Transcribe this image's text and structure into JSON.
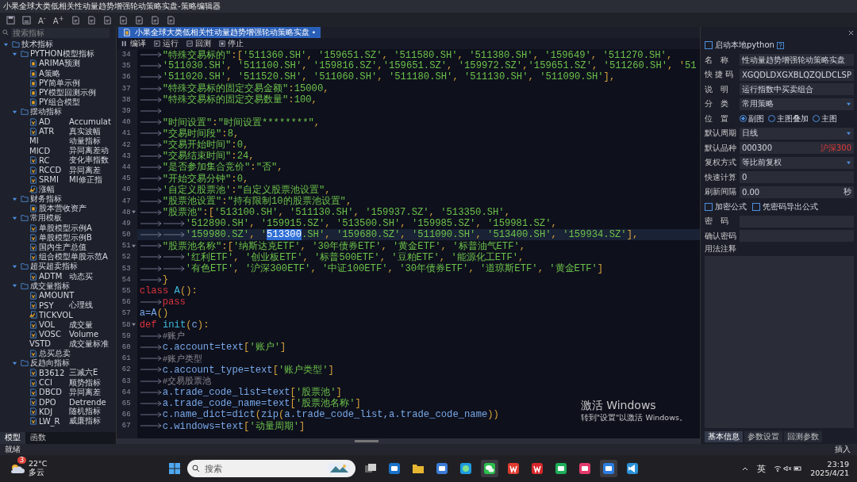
{
  "window": {
    "title": "小果全球大类低相关性动量趋势增强轮动策略实盘-策略编辑器"
  },
  "toolbar": {
    "icons": [
      {
        "kind": "save"
      },
      {
        "kind": "save-as"
      },
      {
        "kind": "font",
        "label": "A$^{-}$"
      },
      {
        "kind": "font",
        "label": "A$^{+}$"
      },
      {
        "kind": "doc"
      },
      {
        "kind": "doc"
      },
      {
        "kind": "doc"
      },
      {
        "kind": "doc"
      },
      {
        "kind": "doc"
      },
      {
        "kind": "doc"
      },
      {
        "kind": "doc"
      }
    ]
  },
  "sidebar": {
    "search": {
      "placeholder": "搜索指标"
    },
    "tree": [
      {
        "label": "技术指标",
        "kind": "folder",
        "expanded": true,
        "children": [
          {
            "label": "PYTHON模型指标",
            "kind": "folder",
            "expanded": true,
            "children": [
              {
                "label": "ARIMA预测",
                "kind": "py"
              },
              {
                "label": "A策略",
                "kind": "py"
              },
              {
                "label": "PY简单示例",
                "kind": "py"
              },
              {
                "label": "PY模型回测示例",
                "kind": "py"
              },
              {
                "label": "PY组合模型",
                "kind": "py"
              }
            ]
          },
          {
            "label": "摆动指标",
            "kind": "folder",
            "expanded": true,
            "children": [
              {
                "label": "AD",
                "desc": "Accumulat",
                "kind": "v"
              },
              {
                "label": "ATR",
                "desc": "真实波幅",
                "kind": "v"
              },
              {
                "label": "MI",
                "desc": "动量指标",
                "kind": "plain"
              },
              {
                "label": "MICD",
                "desc": "异同离差动",
                "kind": "plain"
              },
              {
                "label": "RC",
                "desc": "变化率指数",
                "kind": "v"
              },
              {
                "label": "RCCD",
                "desc": "异同离差",
                "kind": "v"
              },
              {
                "label": "SRMI",
                "desc": "MI修正指",
                "kind": "v"
              },
              {
                "label": "涨幅",
                "kind": "av"
              }
            ]
          },
          {
            "label": "财务指标",
            "kind": "folder",
            "expanded": true,
            "children": [
              {
                "label": "股本营收资产",
                "kind": "py"
              }
            ]
          },
          {
            "label": "常用模板",
            "kind": "folder",
            "expanded": true,
            "children": [
              {
                "label": "单股模型示例A",
                "kind": "v"
              },
              {
                "label": "单股模型示例B",
                "kind": "v"
              },
              {
                "label": "国内生产总值",
                "kind": "v"
              },
              {
                "label": "组合模型单股示范A",
                "kind": "v"
              }
            ]
          },
          {
            "label": "超买超卖指标",
            "kind": "folder",
            "expanded": true,
            "children": [
              {
                "label": "ADTM",
                "desc": "动态买",
                "kind": "v"
              }
            ]
          },
          {
            "label": "成交量指标",
            "kind": "folder",
            "expanded": true,
            "children": [
              {
                "label": "AMOUNT",
                "kind": "v"
              },
              {
                "label": "PSY",
                "desc": "心理线",
                "kind": "v"
              },
              {
                "label": "TICKVOL",
                "kind": "av"
              },
              {
                "label": "VOL",
                "desc": "成交量",
                "kind": "v"
              },
              {
                "label": "VOSC",
                "desc": "Volume",
                "kind": "v"
              },
              {
                "label": "VSTD",
                "desc": "成交量标准",
                "kind": "plain"
              },
              {
                "label": "总买总卖",
                "kind": "v"
              }
            ]
          },
          {
            "label": "反趋向指标",
            "kind": "folder",
            "expanded": true,
            "children": [
              {
                "label": "B3612",
                "desc": "三减六E",
                "kind": "v"
              },
              {
                "label": "CCI",
                "desc": "顺势指标",
                "kind": "v"
              },
              {
                "label": "DBCD",
                "desc": "异同离差",
                "kind": "v"
              },
              {
                "label": "DPO",
                "desc": "Detrende",
                "kind": "v"
              },
              {
                "label": "KDJ",
                "desc": "随机指标",
                "kind": "v"
              },
              {
                "label": "LW_R",
                "desc": "威廉指标",
                "kind": "v"
              }
            ]
          }
        ]
      }
    ],
    "tabs": [
      {
        "label": "模型",
        "selected": true
      },
      {
        "label": "函数",
        "selected": false
      }
    ]
  },
  "editor": {
    "tab": {
      "label": "小果全球大类低相关性动量趋势增强轮动策略实盘",
      "close": "•"
    },
    "actions": [
      {
        "label": "编译",
        "kind": "compile"
      },
      {
        "label": "运行",
        "kind": "run"
      },
      {
        "label": "回测",
        "kind": "backtest"
      },
      {
        "label": "停止",
        "kind": "stop"
      }
    ],
    "lines": [
      {
        "no": "34",
        "kind": "indented",
        "tokens": [
          {
            "kind": "code",
            "t": "\"特殊交易标的\":['511360.SH', '159651.SZ', '511580.SH', '511380.SH', '159649', '511270.SH',"
          }
        ]
      },
      {
        "no": "35",
        "kind": "indented",
        "tokens": [
          {
            "kind": "code",
            "t": "'511030.SH', '511100.SH', '159816.SZ','159651.SZ', '159972.SZ','159651.SZ', '511260.SH', '51"
          }
        ]
      },
      {
        "no": "36",
        "kind": "indented",
        "tokens": [
          {
            "kind": "code",
            "t": "'511020.SH', '511520.SH', '511060.SH', '511180.SH', '511130.SH', '511090.SH'],"
          }
        ]
      },
      {
        "no": "37",
        "kind": "indented",
        "tokens": [
          {
            "kind": "code",
            "t": "\"特殊交易标的固定交易金额\":15000,"
          }
        ]
      },
      {
        "no": "38",
        "kind": "indented",
        "tokens": [
          {
            "kind": "code",
            "t": "\"特殊交易标的固定交易数量\":100,"
          }
        ]
      },
      {
        "no": "39",
        "kind": "indented"
      },
      {
        "no": "40",
        "kind": "indented",
        "tokens": [
          {
            "kind": "code",
            "t": "\"时间设置\":\"时间设置********\","
          }
        ]
      },
      {
        "no": "41",
        "kind": "indented",
        "tokens": [
          {
            "kind": "code",
            "t": "\"交易时间段\":8,"
          }
        ]
      },
      {
        "no": "42",
        "kind": "indented",
        "tokens": [
          {
            "kind": "code",
            "t": "\"交易开始时间\":0,"
          }
        ]
      },
      {
        "no": "43",
        "kind": "indented",
        "tokens": [
          {
            "kind": "code",
            "t": "\"交易结束时间\":24,"
          }
        ]
      },
      {
        "no": "44",
        "kind": "indented",
        "tokens": [
          {
            "kind": "code",
            "t": "\"是否参加集合竞价\":\"否\","
          }
        ]
      },
      {
        "no": "45",
        "kind": "indented",
        "tokens": [
          {
            "kind": "code",
            "t": "\"开始交易分钟\":0,"
          }
        ]
      },
      {
        "no": "46",
        "kind": "indented",
        "tokens": [
          {
            "kind": "code",
            "t": "'自定义股票池':\"自定义股票池设置\","
          }
        ]
      },
      {
        "no": "47",
        "kind": "indented",
        "tokens": [
          {
            "kind": "code",
            "t": "\"股票池设置\":\"持有限制10的股票池设置\","
          }
        ]
      },
      {
        "no": "48",
        "kind": "indented",
        "fold": true,
        "tokens": [
          {
            "kind": "code",
            "t": "\"股票池\":['513100.SH', '511130.SH', '159937.SZ', '513350.SH',"
          }
        ]
      },
      {
        "no": "49",
        "kind": "nested",
        "tokens": [
          {
            "kind": "code",
            "t": "'512890.SH', '159915.SZ', '513500.SH', '159985.SZ', '159981.SZ',"
          }
        ]
      },
      {
        "no": "50",
        "kind": "nested",
        "current": true,
        "tokens": [
          {
            "kind": "code",
            "t": "'159980.SZ', "
          },
          {
            "kind": "str",
            "t": "'"
          },
          {
            "kind": "sel",
            "t": "513300"
          },
          {
            "kind": "str",
            "t": ".SH'"
          },
          {
            "kind": "code",
            "t": ", '159680.SZ', '511090.SH', '513400.SH', '159934.SZ'],"
          }
        ]
      },
      {
        "no": "51",
        "kind": "indented",
        "fold": true,
        "tokens": [
          {
            "kind": "code",
            "t": "\"股票池名称\":['纳斯达克ETF', '30年债券ETF', '黄金ETF', '标普油气ETF',"
          }
        ]
      },
      {
        "no": "52",
        "kind": "nested",
        "tokens": [
          {
            "kind": "code",
            "t": "'红利ETF', '创业板ETF', '标普500ETF', '豆粕ETF', '能源化工ETF',"
          }
        ]
      },
      {
        "no": "53",
        "kind": "nested",
        "tokens": [
          {
            "kind": "code",
            "t": "'有色ETF', '沪深300ETF', '中证100ETF', '30年债券ETF', '道琼斯ETF', '黄金ETF']"
          }
        ]
      },
      {
        "no": "54",
        "kind": "indented",
        "tokens": [
          {
            "kind": "code",
            "t": "}"
          }
        ]
      },
      {
        "no": "55",
        "kind": "plain",
        "tokens": [
          {
            "kind": "kw",
            "t": "class"
          },
          {
            "kind": "fn",
            "t": " A"
          },
          {
            "kind": "code",
            "t": "():"
          }
        ]
      },
      {
        "no": "56",
        "kind": "indented",
        "tokens": [
          {
            "kind": "kw",
            "t": "pass"
          }
        ]
      },
      {
        "no": "57",
        "kind": "plain",
        "tokens": [
          {
            "kind": "id",
            "t": "a=A"
          },
          {
            "kind": "code",
            "t": "()"
          }
        ]
      },
      {
        "no": "58",
        "kind": "plain",
        "fold": true,
        "tokens": [
          {
            "kind": "kw",
            "t": "def"
          },
          {
            "kind": "fn",
            "t": " init"
          },
          {
            "kind": "code",
            "t": "("
          },
          {
            "kind": "id",
            "t": "c"
          },
          {
            "kind": "code",
            "t": "):"
          }
        ]
      },
      {
        "no": "59",
        "kind": "indented",
        "tokens": [
          {
            "kind": "cm",
            "t": "#账户"
          }
        ]
      },
      {
        "no": "60",
        "kind": "indented",
        "tokens": [
          {
            "kind": "id",
            "t": "c.account=text"
          },
          {
            "kind": "code",
            "t": "['账户']"
          }
        ]
      },
      {
        "no": "61",
        "kind": "indented",
        "tokens": [
          {
            "kind": "cm",
            "t": "#账户类型"
          }
        ]
      },
      {
        "no": "62",
        "kind": "indented",
        "tokens": [
          {
            "kind": "id",
            "t": "c.account_type=text"
          },
          {
            "kind": "code",
            "t": "['账户类型']"
          }
        ]
      },
      {
        "no": "63",
        "kind": "indented",
        "tokens": [
          {
            "kind": "cm",
            "t": "#交易股票池"
          }
        ]
      },
      {
        "no": "64",
        "kind": "indented",
        "tokens": [
          {
            "kind": "id",
            "t": "a.trade_code_list=text"
          },
          {
            "kind": "code",
            "t": "['股票池']"
          }
        ]
      },
      {
        "no": "65",
        "kind": "indented",
        "tokens": [
          {
            "kind": "id",
            "t": "a.trade_code_name=text"
          },
          {
            "kind": "code",
            "t": "['股票池名称']"
          }
        ]
      },
      {
        "no": "66",
        "kind": "indented",
        "tokens": [
          {
            "kind": "id",
            "t": "c.name_dict=dict"
          },
          {
            "kind": "code",
            "t": "("
          },
          {
            "kind": "id",
            "t": "zip"
          },
          {
            "kind": "code",
            "t": "("
          },
          {
            "kind": "id",
            "t": "a.trade_code_list,a.trade_code_name"
          },
          {
            "kind": "code",
            "t": "))"
          }
        ]
      },
      {
        "no": "67",
        "kind": "indented",
        "tokens": [
          {
            "kind": "id",
            "t": "c.windows=text"
          },
          {
            "kind": "code",
            "t": "['动量周期']"
          }
        ]
      }
    ]
  },
  "properties": {
    "local_python": {
      "label": "启动本地python",
      "checked": false
    },
    "rows": [
      {
        "kind": "input",
        "label": "名　称",
        "value": "性动量趋势增强轮动策略实盘"
      },
      {
        "kind": "input",
        "label": "快 捷 码",
        "value": "XGQDLDXGXBLQZQLDCLSP"
      },
      {
        "kind": "input",
        "label": "说　明",
        "value": "运行指数中买卖组合"
      },
      {
        "kind": "select",
        "label": "分　类",
        "value": "常用策略"
      },
      {
        "kind": "radio",
        "label": "位　置",
        "options": [
          {
            "label": "副图",
            "selected": true
          },
          {
            "label": "主图叠加",
            "selected": false
          },
          {
            "label": "主图",
            "selected": false
          }
        ]
      },
      {
        "kind": "select",
        "label": "默认周期",
        "value": "日线"
      },
      {
        "kind": "input",
        "label": "默认品种",
        "value": "000300",
        "note": "沪深300"
      },
      {
        "kind": "select",
        "label": "复权方式",
        "value": "等比前复权"
      },
      {
        "kind": "input",
        "label": "快速计算",
        "value": "0"
      },
      {
        "kind": "input",
        "label": "刷新间隔",
        "value": "0.00",
        "suffix": "秒"
      },
      {
        "kind": "checks",
        "options": [
          {
            "label": "加密公式",
            "checked": false
          },
          {
            "label": "凭密码导出公式",
            "checked": false
          }
        ]
      },
      {
        "kind": "input",
        "label": "密　码"
      },
      {
        "kind": "input",
        "label": "确认密码"
      },
      {
        "kind": "textarea",
        "label": "用法注释"
      }
    ],
    "tabs": [
      {
        "label": "基本信息",
        "selected": true
      },
      {
        "label": "参数设置",
        "selected": false
      },
      {
        "label": "回测参数",
        "selected": false
      }
    ]
  },
  "activation_notice": {
    "title": "激活 Windows",
    "hint": "转到\"设置\"以激活 Windows。"
  },
  "status_bar": {
    "left": "就绪",
    "right": "插入"
  },
  "taskbar": {
    "weather": {
      "temp": "22°C",
      "desc": "多云",
      "badge": "3"
    },
    "search": {
      "placeholder": "搜索"
    },
    "apps": [
      {
        "kind": "taskview",
        "active": false
      },
      {
        "kind": "mail",
        "active": false
      },
      {
        "kind": "folder",
        "active": false
      },
      {
        "kind": "store",
        "active": false
      },
      {
        "kind": "browser",
        "active": false
      },
      {
        "kind": "chat",
        "active": true
      },
      {
        "kind": "wps",
        "active": false
      },
      {
        "kind": "red",
        "active": false
      },
      {
        "kind": "green",
        "active": false
      },
      {
        "kind": "pink",
        "active": false
      },
      {
        "kind": "blue",
        "active": true
      },
      {
        "kind": "code",
        "active": false
      }
    ],
    "ime": "英",
    "time": "23:19",
    "date": "2025/4/21"
  }
}
